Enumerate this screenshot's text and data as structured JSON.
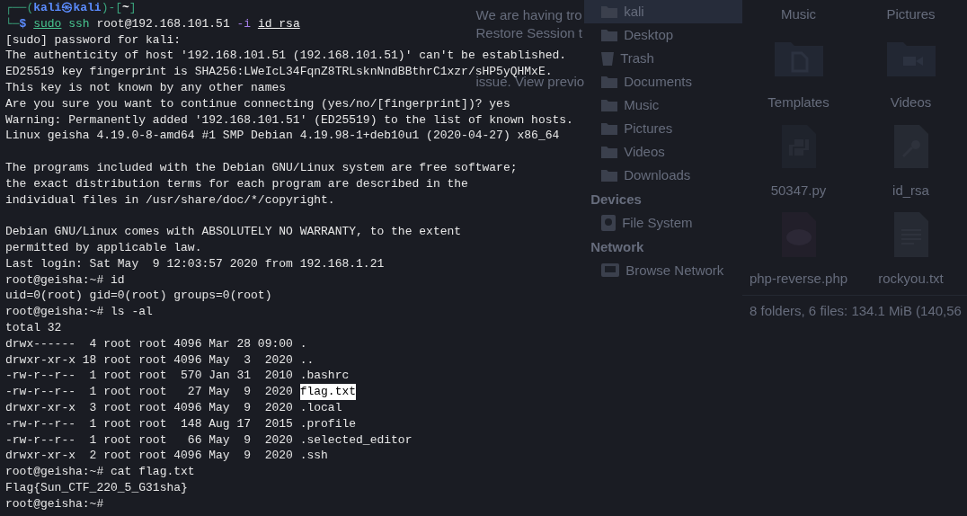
{
  "background": {
    "notice_lines": [
      "We are having tro",
      "Restore Session t",
      "issue. View previo"
    ],
    "file_manager": {
      "sidebar": [
        {
          "kind": "folder",
          "label": "kali",
          "selected": true
        },
        {
          "kind": "folder",
          "label": "Desktop",
          "selected": false
        },
        {
          "kind": "trash",
          "label": "Trash",
          "selected": false
        },
        {
          "kind": "folder",
          "label": "Documents",
          "selected": false
        },
        {
          "kind": "folder",
          "label": "Music",
          "selected": false
        },
        {
          "kind": "folder",
          "label": "Pictures",
          "selected": false
        },
        {
          "kind": "folder",
          "label": "Videos",
          "selected": false
        },
        {
          "kind": "folder",
          "label": "Downloads",
          "selected": false
        },
        {
          "kind": "heading",
          "label": "Devices"
        },
        {
          "kind": "drive",
          "label": "File System",
          "selected": false
        },
        {
          "kind": "heading",
          "label": "Network"
        },
        {
          "kind": "network",
          "label": "Browse Network",
          "selected": false
        }
      ],
      "files": [
        {
          "kind": "label-only",
          "label": "Music"
        },
        {
          "kind": "label-only",
          "label": "Pictures"
        },
        {
          "kind": "folder-document",
          "label": "Templates"
        },
        {
          "kind": "folder-video",
          "label": "Videos"
        },
        {
          "kind": "python",
          "label": "50347.py"
        },
        {
          "kind": "key",
          "label": "id_rsa"
        },
        {
          "kind": "php",
          "label": "php-reverse.php"
        },
        {
          "kind": "text",
          "label": "rockyou.txt"
        }
      ],
      "status": "8 folders, 6 files: 134.1 MiB (140,56"
    }
  },
  "terminal": {
    "lines": [
      {
        "kind": "segments",
        "segments": [
          {
            "kind": "frame",
            "text": "┌──("
          },
          {
            "kind": "host",
            "text": "kali㉿kali"
          },
          {
            "kind": "frame",
            "text": ")-["
          },
          {
            "kind": "path",
            "text": "~"
          },
          {
            "kind": "frame",
            "text": "]"
          }
        ]
      },
      {
        "kind": "segments",
        "segments": [
          {
            "kind": "frame",
            "text": "└─"
          },
          {
            "kind": "prompt",
            "text": "$ "
          },
          {
            "kind": "command-underlined",
            "text": "sudo"
          },
          {
            "kind": "command",
            "text": " ssh"
          },
          {
            "kind": "plain",
            "text": " root@192.168.101.51"
          },
          {
            "kind": "option",
            "text": " -i "
          },
          {
            "kind": "file-underlined",
            "text": "id_rsa"
          }
        ]
      },
      {
        "kind": "text",
        "text": "[sudo] password for kali:"
      },
      {
        "kind": "text",
        "text": "The authenticity of host '192.168.101.51 (192.168.101.51)' can't be established."
      },
      {
        "kind": "text",
        "text": "ED25519 key fingerprint is SHA256:LWeIcL34FqnZ8TRLsknNndBBthrC1xzr/sHP5yQHMxE."
      },
      {
        "kind": "text",
        "text": "This key is not known by any other names"
      },
      {
        "kind": "text",
        "text": "Are you sure you want to continue connecting (yes/no/[fingerprint])? yes"
      },
      {
        "kind": "text",
        "text": "Warning: Permanently added '192.168.101.51' (ED25519) to the list of known hosts."
      },
      {
        "kind": "text",
        "text": "Linux geisha 4.19.0-8-amd64 #1 SMP Debian 4.19.98-1+deb10u1 (2020-04-27) x86_64"
      },
      {
        "kind": "blank"
      },
      {
        "kind": "text",
        "text": "The programs included with the Debian GNU/Linux system are free software;"
      },
      {
        "kind": "text",
        "text": "the exact distribution terms for each program are described in the"
      },
      {
        "kind": "text",
        "text": "individual files in /usr/share/doc/*/copyright."
      },
      {
        "kind": "blank"
      },
      {
        "kind": "text",
        "text": "Debian GNU/Linux comes with ABSOLUTELY NO WARRANTY, to the extent"
      },
      {
        "kind": "text",
        "text": "permitted by applicable law."
      },
      {
        "kind": "text",
        "text": "Last login: Sat May  9 12:03:57 2020 from 192.168.1.21"
      },
      {
        "kind": "text",
        "text": "root@geisha:~# id"
      },
      {
        "kind": "text",
        "text": "uid=0(root) gid=0(root) groups=0(root)"
      },
      {
        "kind": "text",
        "text": "root@geisha:~# ls -al"
      },
      {
        "kind": "text",
        "text": "total 32"
      },
      {
        "kind": "text",
        "text": "drwx------  4 root root 4096 Mar 28 09:00 ."
      },
      {
        "kind": "text",
        "text": "drwxr-xr-x 18 root root 4096 May  3  2020 .."
      },
      {
        "kind": "text",
        "text": "-rw-r--r--  1 root root  570 Jan 31  2010 .bashrc"
      },
      {
        "kind": "segments",
        "segments": [
          {
            "kind": "plain",
            "text": "-rw-r--r--  1 root root   27 May  9  2020 "
          },
          {
            "kind": "highlight",
            "text": "flag.txt"
          }
        ]
      },
      {
        "kind": "text",
        "text": "drwxr-xr-x  3 root root 4096 May  9  2020 .local"
      },
      {
        "kind": "text",
        "text": "-rw-r--r--  1 root root  148 Aug 17  2015 .profile"
      },
      {
        "kind": "text",
        "text": "-rw-r--r--  1 root root   66 May  9  2020 .selected_editor"
      },
      {
        "kind": "text",
        "text": "drwxr-xr-x  2 root root 4096 May  9  2020 .ssh"
      },
      {
        "kind": "text",
        "text": "root@geisha:~# cat flag.txt"
      },
      {
        "kind": "text",
        "text": "Flag{Sun_CTF_220_5_G31sha}"
      },
      {
        "kind": "text",
        "text": "root@geisha:~#"
      }
    ]
  }
}
